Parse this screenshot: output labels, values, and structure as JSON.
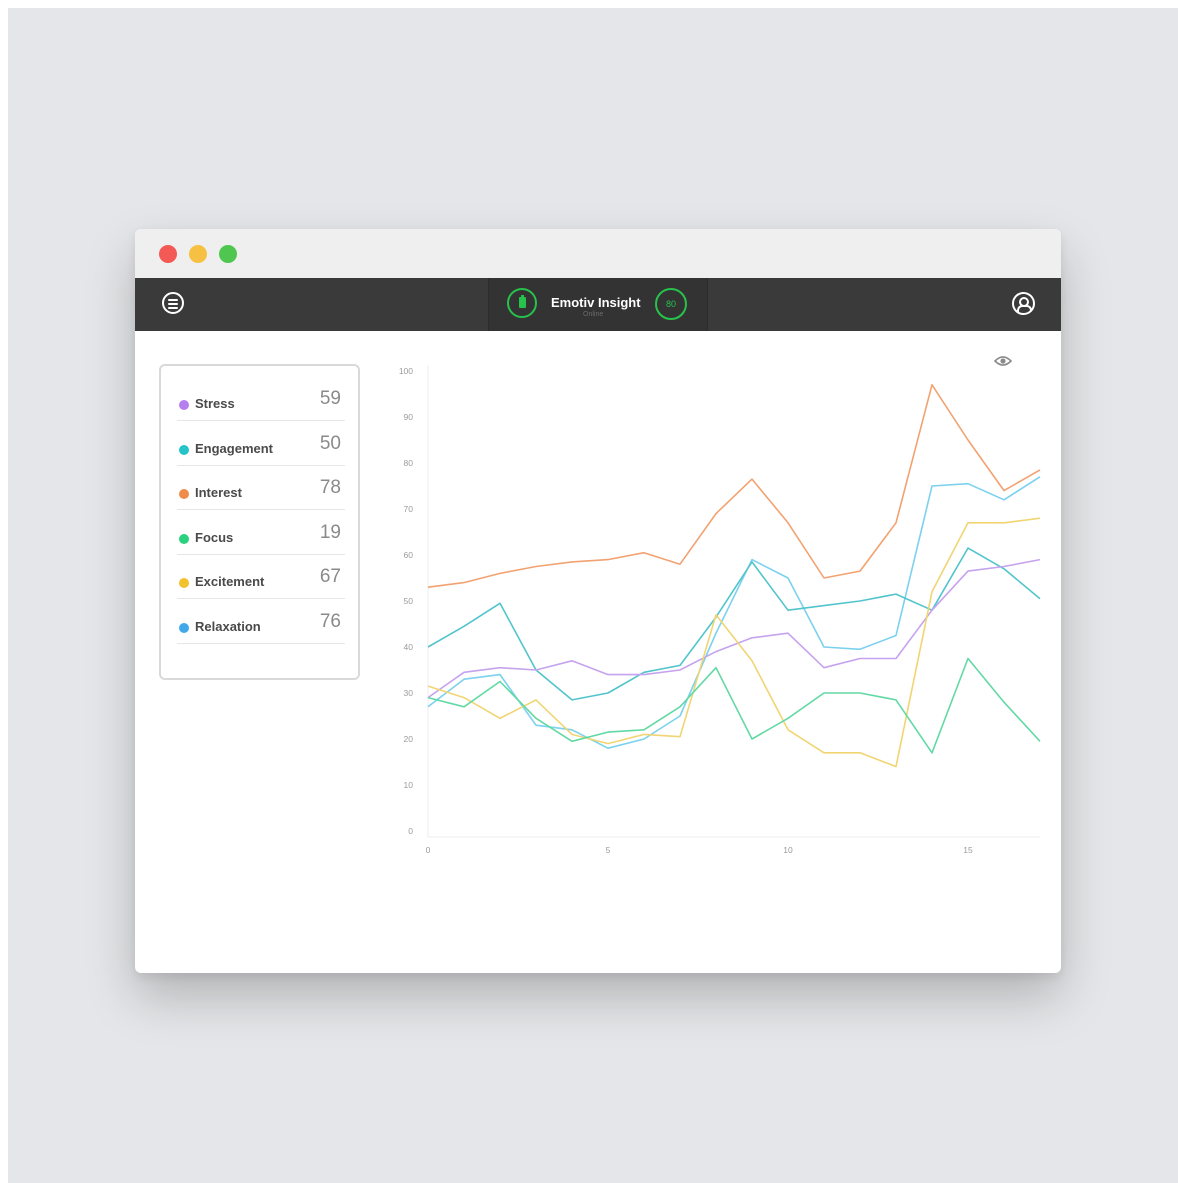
{
  "window": {
    "controls": [
      "close",
      "minimize",
      "maximize"
    ]
  },
  "toolbar": {
    "menu_icon": "menu-icon",
    "device_icon": "battery-icon",
    "device_name": "Emotiv Insight",
    "device_status": "Online",
    "device_score": "80",
    "user_icon": "user-icon"
  },
  "metrics": [
    {
      "label": "Stress",
      "value": "59",
      "color": "#b57fee"
    },
    {
      "label": "Engagement",
      "value": "50",
      "color": "#23c3c9"
    },
    {
      "label": "Interest",
      "value": "78",
      "color": "#f08c4a"
    },
    {
      "label": "Focus",
      "value": "19",
      "color": "#2bd17f"
    },
    {
      "label": "Excitement",
      "value": "67",
      "color": "#f2c12e"
    },
    {
      "label": "Relaxation",
      "value": "76",
      "color": "#3fa9ea"
    }
  ],
  "chart_data": {
    "type": "line",
    "x": [
      0,
      1,
      2,
      3,
      4,
      5,
      6,
      7,
      8,
      9,
      10,
      11,
      12,
      13,
      14,
      15,
      16,
      17
    ],
    "xticks": [
      "0",
      "5",
      "10",
      "15"
    ],
    "yticks": [
      "0",
      "10",
      "20",
      "30",
      "40",
      "50",
      "60",
      "70",
      "80",
      "90",
      "100"
    ],
    "xlim": [
      0,
      17
    ],
    "ylim": [
      0,
      100
    ],
    "legend": "none",
    "series": [
      {
        "color": "#f2a271",
        "values": [
          53,
          54,
          56,
          57.5,
          58.5,
          59,
          60.5,
          58,
          69,
          76.5,
          67,
          55,
          56.5,
          67,
          97,
          85,
          74,
          78.5
        ]
      },
      {
        "color": "#7bd1ee",
        "values": [
          27,
          33,
          34,
          23,
          22,
          18,
          20,
          25,
          43,
          59,
          55,
          40,
          39.5,
          42.5,
          75,
          75.5,
          72,
          77
        ]
      },
      {
        "color": "#52c4cc",
        "values": [
          40,
          44.5,
          49.5,
          35,
          28.5,
          30,
          34.5,
          36,
          46.5,
          58.5,
          48,
          49,
          50,
          51.5,
          48,
          61.5,
          57,
          50.5
        ]
      },
      {
        "color": "#c5a3ee",
        "values": [
          29,
          34.5,
          35.5,
          35,
          37,
          34,
          34,
          35,
          39,
          42,
          43,
          35.5,
          37.5,
          37.5,
          48,
          56.5,
          57.5,
          59
        ]
      },
      {
        "color": "#f0d572",
        "values": [
          31.5,
          29,
          24.5,
          28.5,
          21,
          19,
          21,
          20.5,
          47,
          37,
          22,
          17,
          17,
          14,
          52,
          67,
          67,
          68
        ]
      },
      {
        "color": "#62d9a5",
        "values": [
          29,
          27,
          32.5,
          24.5,
          19.5,
          21.5,
          22,
          27,
          35.5,
          20,
          24.5,
          30,
          30,
          28.5,
          17,
          37.5,
          28,
          19.5
        ]
      }
    ]
  },
  "chart_tools": {
    "visibility_icon": "eye-icon"
  }
}
